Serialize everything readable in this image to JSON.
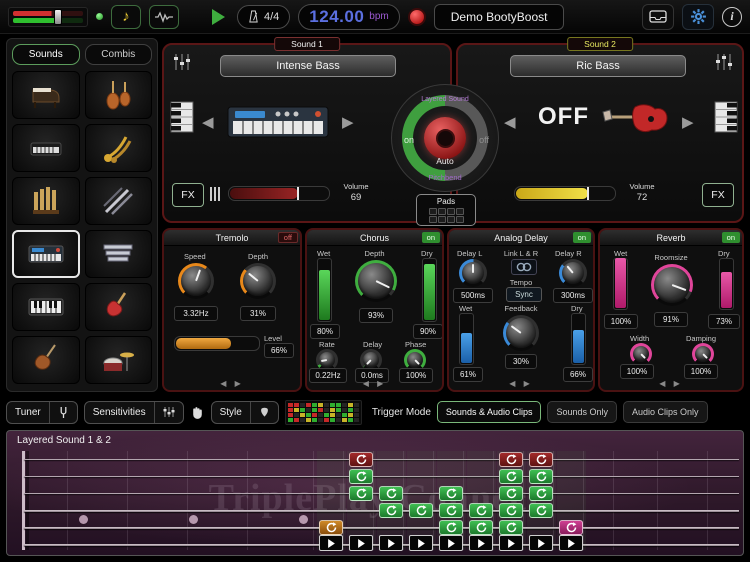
{
  "icons": {
    "note": "♪",
    "info": "i"
  },
  "ui": {
    "arrow_left": "◀",
    "arrow_right": "▶",
    "pager": "◀ ▶"
  },
  "top_bar": {
    "time_signature": "4/4",
    "tempo": "124.00",
    "tempo_unit": "bpm",
    "preset": "Demo BootyBoost"
  },
  "sidebar": {
    "tabs": [
      {
        "label": "Sounds",
        "active": true
      },
      {
        "label": "Combis",
        "active": false
      }
    ],
    "instruments": [
      {
        "icon": "grand-piano",
        "selected": false
      },
      {
        "icon": "strings",
        "selected": false
      },
      {
        "icon": "electric-piano",
        "selected": false
      },
      {
        "icon": "brass",
        "selected": false
      },
      {
        "icon": "organ",
        "selected": false
      },
      {
        "icon": "woodwinds",
        "selected": false
      },
      {
        "icon": "synth",
        "selected": true
      },
      {
        "icon": "mallets",
        "selected": false
      },
      {
        "icon": "keyboard",
        "selected": false
      },
      {
        "icon": "electric-guitar",
        "selected": false
      },
      {
        "icon": "bass-guitar",
        "selected": false
      },
      {
        "icon": "drums",
        "selected": false
      }
    ]
  },
  "sound1": {
    "label": "Sound 1",
    "name": "Intense Bass",
    "fx": "FX",
    "volume_label": "Volume",
    "volume": "69"
  },
  "sound2": {
    "label": "Sound 2",
    "name": "Ric Bass",
    "display": "OFF",
    "fx": "FX",
    "volume_label": "Volume",
    "volume": "72"
  },
  "layered": {
    "title": "Layered Sound",
    "on": "on",
    "off": "off",
    "auto": "Auto",
    "pitchbend": "Pitchbend",
    "pads": "Pads"
  },
  "effects": {
    "tremolo": {
      "title": "Tremolo",
      "state": "off",
      "speed_label": "Speed",
      "speed_value": "3.32Hz",
      "depth_label": "Depth",
      "depth_value": "31%",
      "level_label": "Level",
      "level_value": "66%"
    },
    "chorus": {
      "title": "Chorus",
      "state": "on",
      "wet_label": "Wet",
      "wet_value": "80%",
      "dry_label": "Dry",
      "dry_value": "90%",
      "depth_label": "Depth",
      "depth_value": "93%",
      "rate_label": "Rate",
      "rate_value": "0.22Hz",
      "delay_label": "Delay",
      "delay_value": "0.0ms",
      "phase_label": "Phase",
      "phase_value": "100%"
    },
    "analog_delay": {
      "title": "Analog Delay",
      "state": "on",
      "delay_l_label": "Delay L",
      "delay_l_value": "500ms",
      "link_label": "Link L & R",
      "delay_r_label": "Delay R",
      "delay_r_value": "300ms",
      "tempo_label": "Tempo",
      "sync_label": "Sync",
      "wet_label": "Wet",
      "wet_value": "61%",
      "feedback_label": "Feedback",
      "feedback_value": "30%",
      "dry_label": "Dry",
      "dry_value": "66%"
    },
    "reverb": {
      "title": "Reverb",
      "state": "on",
      "wet_label": "Wet",
      "wet_value": "100%",
      "dry_label": "Dry",
      "dry_value": "73%",
      "roomsize_label": "Roomsize",
      "roomsize_value": "91%",
      "width_label": "Width",
      "width_value": "100%",
      "damping_label": "Damping",
      "damping_value": "100%"
    }
  },
  "control_bar": {
    "tuner": "Tuner",
    "sensitivities": "Sensitivities",
    "style": "Style",
    "trigger_mode": "Trigger Mode",
    "modes": [
      {
        "label": "Sounds & Audio Clips",
        "active": true
      },
      {
        "label": "Sounds Only",
        "active": false
      },
      {
        "label": "Audio Clips Only",
        "active": false
      }
    ],
    "meter_pattern": [
      "rrdrgydggdyd",
      "rygdgrdygdgd",
      "rdygrdgydgyd",
      "grdygdrgdygd"
    ]
  },
  "fretboard": {
    "label": "Layered Sound 1 & 2",
    "watermark": "TriplePlay Connect",
    "clip_colors": {
      "green": "#2fae3f",
      "red": "#8a2020",
      "orange": "#c87818",
      "pink": "#c23a86"
    },
    "columns": [
      {
        "cells": [
          {
            "row": 4,
            "color": "orange"
          }
        ]
      },
      {
        "cells": [
          {
            "row": 0,
            "color": "red"
          },
          {
            "row": 1,
            "color": "green"
          },
          {
            "row": 2,
            "color": "green"
          }
        ]
      },
      {
        "cells": [
          {
            "row": 2,
            "color": "green"
          },
          {
            "row": 3,
            "color": "green"
          }
        ]
      },
      {
        "cells": [
          {
            "row": 3,
            "color": "green"
          }
        ]
      },
      {
        "cells": [
          {
            "row": 2,
            "color": "green"
          },
          {
            "row": 3,
            "color": "green"
          },
          {
            "row": 4,
            "color": "green"
          }
        ]
      },
      {
        "cells": [
          {
            "row": 3,
            "color": "green"
          },
          {
            "row": 4,
            "color": "green"
          }
        ]
      },
      {
        "cells": [
          {
            "row": 0,
            "color": "red"
          },
          {
            "row": 1,
            "color": "green"
          },
          {
            "row": 2,
            "color": "green"
          },
          {
            "row": 3,
            "color": "green"
          },
          {
            "row": 4,
            "color": "green"
          }
        ]
      },
      {
        "cells": [
          {
            "row": 0,
            "color": "red"
          },
          {
            "row": 1,
            "color": "green"
          },
          {
            "row": 2,
            "color": "green"
          },
          {
            "row": 3,
            "color": "green"
          }
        ]
      },
      {
        "cells": [
          {
            "row": 4,
            "color": "pink"
          }
        ]
      }
    ]
  }
}
